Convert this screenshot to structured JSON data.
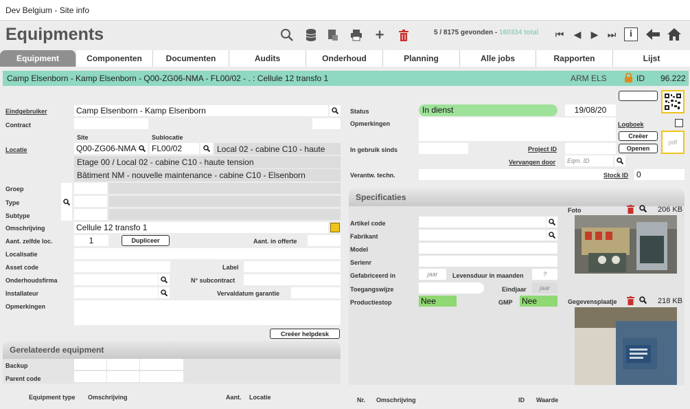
{
  "window": {
    "title": "Dev Belgium - Site info"
  },
  "header": {
    "title": "Equipments",
    "count_text": "5 / 8175 gevonden - ",
    "total_text": "160334 total"
  },
  "tabs": [
    "Equipment",
    "Componenten",
    "Documenten",
    "Audits",
    "Onderhoud",
    "Planning",
    "Alle jobs",
    "Rapporten",
    "Lijst"
  ],
  "banner": {
    "path": "Camp Elsenborn - Kamp Elsenborn - Q00-ZG06-NMA - FL00/02 - . : Cellule 12 transfo 1",
    "code": "ARM ELS",
    "id_label": "ID",
    "id_value": "96.222"
  },
  "left": {
    "eindgebruiker_label": "Eindgebruiker",
    "eindgebruiker": "Camp Elsenborn - Kamp Elsenborn",
    "contract_label": "Contract",
    "site_label": "Site",
    "sublocatie_label": "Sublocatie",
    "locatie_label": "Locatie",
    "site": "Q00-ZG06-NMA",
    "sublocatie": "FL00/02",
    "locatie_desc1": "Local 02 - cabine C10 - haute",
    "locatie_desc2": "Etage 00 / Local 02 - cabine C10 - haute tension",
    "locatie_desc3": "Bâtiment NM - nouvelle maintenance - cabine C10 - Elsenborn",
    "groep_label": "Groep",
    "type_label": "Type",
    "subtype_label": "Subtype",
    "omschrijving_label": "Omschrijving",
    "omschrijving": "Cellule 12 transfo 1",
    "aant_label": "Aant. zelfde loc.",
    "aant": "1",
    "dupliceer": "Dupliceer",
    "aant_offerte_label": "Aant. in offerte",
    "localisatie_label": "Localisatie",
    "asset_label": "Asset code",
    "label_label": "Label",
    "onderhoud_label": "Onderhoudsfirma",
    "subcontract_label": "N° subcontract",
    "installateur_label": "Installateur",
    "vervaldatum_label": "Vervaldatum garantie",
    "opmerkingen_label": "Opmerkingen",
    "helpdesk": "Creëer helpdesk"
  },
  "related": {
    "title": "Gerelateerde equipment",
    "backup_label": "Backup",
    "parent_label": "Parent code",
    "cols": [
      "Equipment type",
      "Omschrijving",
      "Aant.",
      "Locatie"
    ]
  },
  "right": {
    "status_label": "Status",
    "status": "In dienst",
    "status_date": "19/08/20",
    "opmerkingen_label": "Opmerkingen",
    "logboek_label": "Logboek",
    "creeer": "Creëer",
    "openen": "Openen",
    "pdf": "pdf",
    "gebruik_label": "In gebruik sinds",
    "project_label": "Project ID",
    "vervangen_label": "Vervangen door",
    "eqm_placeholder": "Eqm. ID",
    "verantw_label": "Verantw. techn.",
    "stock_label": "Stock ID",
    "stock": "0"
  },
  "specs": {
    "title": "Specificaties",
    "artikel_label": "Artikel code",
    "fabrikant_label": "Fabrikant",
    "model_label": "Model",
    "serienr_label": "Serienr",
    "gefabriceerd_label": "Gefabriceerd in",
    "jaar_placeholder": "jaar",
    "levensduur_label": "Levensduur in maanden",
    "levensduur_placeholder": "?",
    "toegang_label": "Toegangswijze",
    "eindjaar_label": "Eindjaar",
    "productiestop_label": "Productiestop",
    "productiestop": "Nee",
    "gmp_label": "GMP",
    "gmp": "Nee",
    "cols": [
      "Nr.",
      "Omschrijving",
      "ID",
      "Waarde"
    ]
  },
  "photos": {
    "foto_label": "Foto",
    "foto_size": "206 KB",
    "plaat_label": "Gegevensplaatje",
    "plaat_size": "218 KB"
  },
  "colors": {
    "accent_green": "#8fd8c2",
    "status_green": "#9ee29a",
    "nee_green": "#8fd873",
    "trash_red": "#c9302c"
  }
}
